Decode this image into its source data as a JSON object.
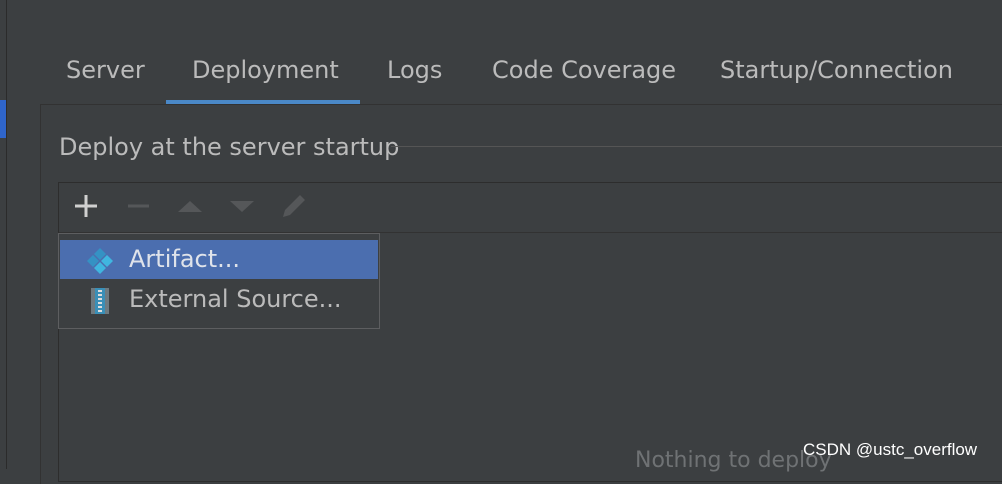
{
  "tabs": [
    {
      "label": "Server",
      "selected": false
    },
    {
      "label": "Deployment",
      "selected": true
    },
    {
      "label": "Logs",
      "selected": false
    },
    {
      "label": "Code Coverage",
      "selected": false
    },
    {
      "label": "Startup/Connection",
      "selected": false
    }
  ],
  "deploy_section": {
    "title": "Deploy at the server startup",
    "empty_text": "Nothing to deploy"
  },
  "toolbar": {
    "buttons": [
      {
        "icon": "add-icon",
        "enabled": true
      },
      {
        "icon": "remove-icon",
        "enabled": false
      },
      {
        "icon": "move-up-icon",
        "enabled": false
      },
      {
        "icon": "move-down-icon",
        "enabled": false
      },
      {
        "icon": "edit-icon",
        "enabled": false
      }
    ]
  },
  "add_popup": {
    "items": [
      {
        "label": "Artifact...",
        "icon": "artifact-icon",
        "selected": true
      },
      {
        "label": "External Source...",
        "icon": "external-source-icon",
        "selected": false
      }
    ]
  },
  "colors": {
    "background": "#3c3f41",
    "tab_underline": "#4a88c7",
    "selection": "#4b6eaf",
    "text": "#bbbbbb"
  },
  "watermark": "CSDN @ustc_overflow"
}
